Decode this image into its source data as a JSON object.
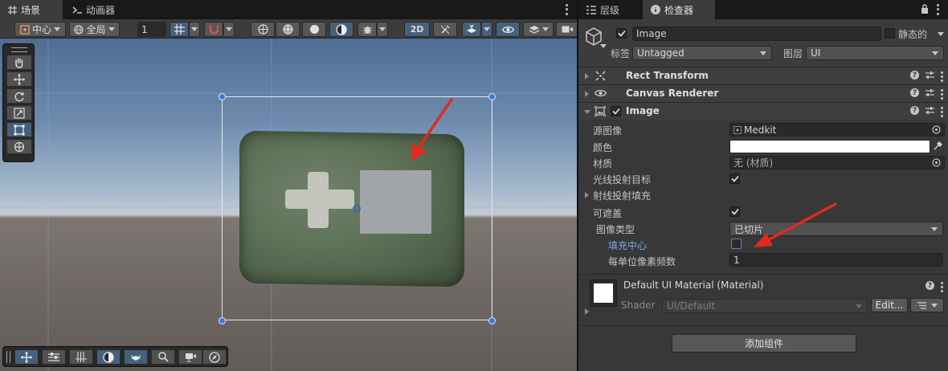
{
  "tabs_left": [
    {
      "label": "场景",
      "icon": "grid-icon",
      "active": true
    },
    {
      "label": "动画器",
      "icon": "animator-icon",
      "active": false
    }
  ],
  "tabs_right": [
    {
      "label": "层级",
      "icon": "hierarchy-icon",
      "active": false
    },
    {
      "label": "检查器",
      "icon": "info-icon",
      "active": true
    }
  ],
  "scene_toolbar": {
    "pivot_label": "中心",
    "space_label": "全局",
    "grid_value": "1",
    "mode_2d_label": "2D"
  },
  "inspector": {
    "object_name": "Image",
    "object_enabled": true,
    "static_label": "静态的",
    "static_checked": false,
    "tag_label": "标签",
    "tag_value": "Untagged",
    "layer_label": "图层",
    "layer_value": "UI",
    "components": [
      {
        "title": "Rect Transform",
        "expanded": false
      },
      {
        "title": "Canvas Renderer",
        "expanded": false
      },
      {
        "title": "Image",
        "expanded": true,
        "enabled": true
      }
    ],
    "image_fields": {
      "source_image_label": "源图像",
      "source_image_value": "Medkit",
      "color_label": "颜色",
      "color_value": "#ffffff",
      "material_label": "材质",
      "material_value": "无 (材质)",
      "raycast_target_label": "光线投射目标",
      "raycast_target_checked": true,
      "raycast_padding_label": "射线投射填充",
      "maskable_label": "可遮盖",
      "maskable_checked": true,
      "image_type_label": "图像类型",
      "image_type_value": "已切片",
      "fill_center_label": "填充中心",
      "fill_center_checked": false,
      "ppu_label": "每单位像素频数",
      "ppu_value": "1"
    },
    "material_block": {
      "title": "Default UI Material (Material)",
      "shader_label": "Shader",
      "shader_value": "UI/Default",
      "edit_label": "Edit..."
    },
    "add_component_label": "添加组件"
  },
  "colors": {
    "accent_blue": "#46607c",
    "arrow_red": "#e02a1f",
    "fill_center_label_color": "#7fa7e6"
  }
}
